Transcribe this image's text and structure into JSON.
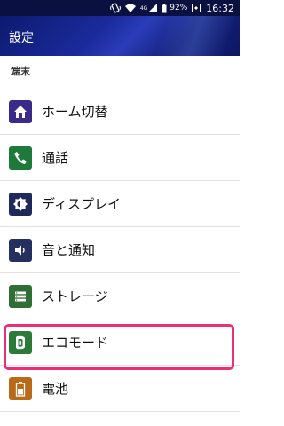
{
  "status_bar": {
    "network_label": "4G",
    "battery_percent": "92%",
    "time": "16:32"
  },
  "app_bar": {
    "title": "設定"
  },
  "section": {
    "title": "端末"
  },
  "items": [
    {
      "label": "ホーム切替",
      "icon": "home-icon",
      "icon_color": "#3a2a8a"
    },
    {
      "label": "通話",
      "icon": "phone-icon",
      "icon_color": "#1e7a3a"
    },
    {
      "label": "ディスプレイ",
      "icon": "brightness-icon",
      "icon_color": "#1f2a5a"
    },
    {
      "label": "音と通知",
      "icon": "speaker-icon",
      "icon_color": "#253060"
    },
    {
      "label": "ストレージ",
      "icon": "storage-icon",
      "icon_color": "#2f6e34"
    },
    {
      "label": "エコモード",
      "icon": "eco-icon",
      "icon_color": "#2b7a3a"
    },
    {
      "label": "電池",
      "icon": "battery-icon",
      "icon_color": "#b86a18"
    }
  ],
  "highlight_color": "#ee2d77"
}
